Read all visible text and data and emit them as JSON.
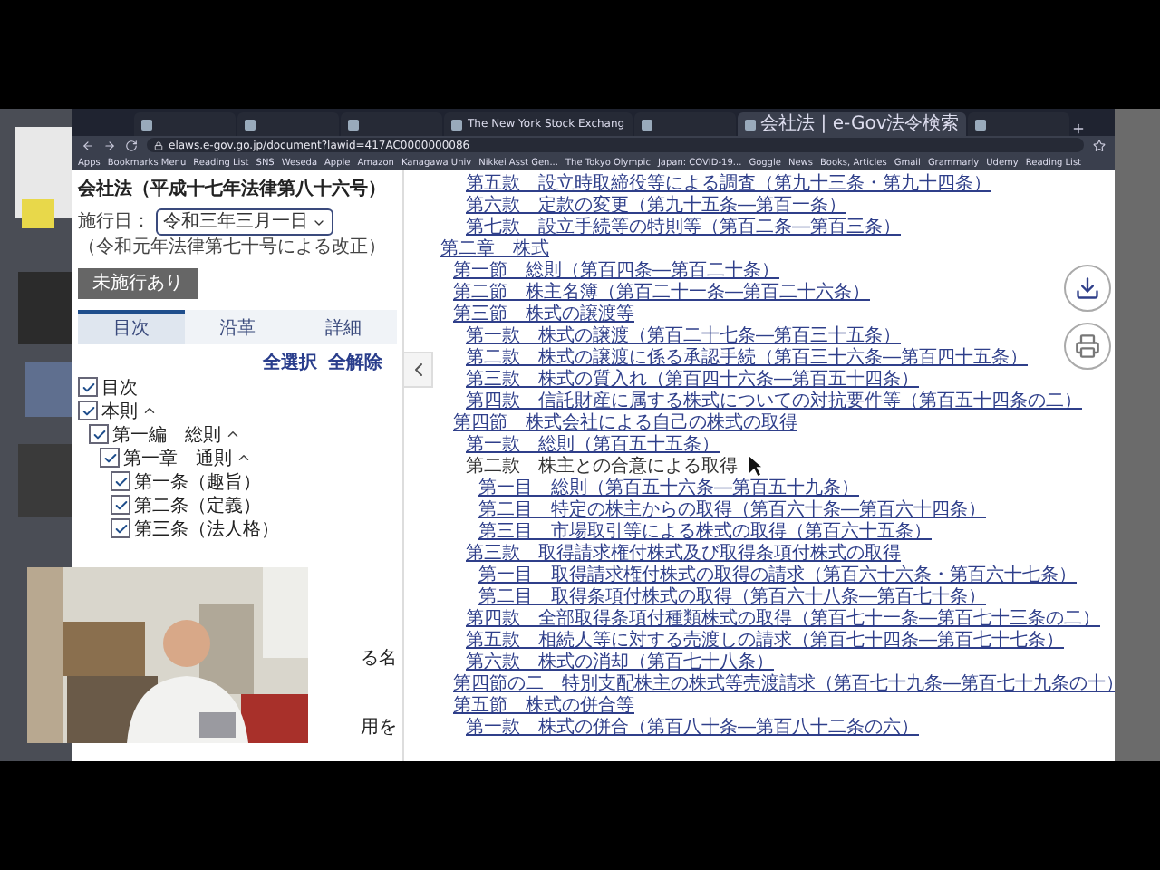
{
  "browser": {
    "tabs": [
      {
        "selected": false
      },
      {
        "selected": false
      },
      {
        "selected": false
      },
      {
        "title": "The New York Stock Exchang",
        "selected": false
      },
      {
        "selected": false
      },
      {
        "title": "会社法 | e-Gov法令検索",
        "selected": true
      },
      {
        "selected": false
      }
    ],
    "address": "elaws.e-gov.go.jp/document?lawid=417AC0000000086",
    "bookmarks": [
      "Apps",
      "Bookmarks Menu",
      "Reading List",
      "SNS",
      "Weseda",
      "Apple",
      "Amazon",
      "Kanagawa Univ",
      "Nikkei Asst Gen...",
      "The Tokyo Olympic",
      "Japan: COVID-19...",
      "Goggle",
      "News",
      "Books, Articles",
      "Gmail",
      "Grammarly",
      "Udemy",
      "Reading List"
    ]
  },
  "sidebar": {
    "law_title": "会社法（平成十七年法律第八十六号）",
    "effective_label": "施行日：",
    "effective_date": "令和三年三月一日",
    "amendment_note": "（令和元年法律第七十号による改正）",
    "pending_button": "未施行あり",
    "tabs": [
      {
        "label": "目次",
        "selected": true
      },
      {
        "label": "沿革",
        "selected": false
      },
      {
        "label": "詳細",
        "selected": false
      }
    ],
    "select_all": "全選択",
    "clear_all": "全解除",
    "tree": [
      {
        "label": "目次",
        "checked": true
      },
      {
        "label": "本則",
        "checked": true,
        "expanded": true,
        "children": [
          {
            "label": "第一編　総則",
            "checked": true,
            "expanded": true,
            "children": [
              {
                "label": "第一章　通則",
                "checked": true,
                "expanded": true,
                "children": [
                  {
                    "label": "第一条（趣旨）",
                    "checked": true
                  },
                  {
                    "label": "第二条（定義）",
                    "checked": true
                  },
                  {
                    "label": "第三条（法人格）",
                    "checked": true
                  }
                ]
              }
            ]
          }
        ]
      }
    ],
    "fragments": [
      "る名",
      "用を"
    ]
  },
  "toc": [
    {
      "children": [
        {
          "children": [
            {
              "text": "第五款　設立時取締役等による調査（第九十三条・第九十四条）",
              "link": true
            },
            {
              "text": "第六款　定款の変更（第九十五条―第百一条）",
              "link": true
            },
            {
              "text": "第七款　設立手続等の特則等（第百二条―第百三条）",
              "link": true
            }
          ]
        }
      ]
    },
    {
      "text": "第二章　株式",
      "link": true,
      "children": [
        {
          "text": "第一節　総則（第百四条―第百二十条）",
          "link": true
        },
        {
          "text": "第二節　株主名簿（第百二十一条―第百二十六条）",
          "link": true
        },
        {
          "text": "第三節　株式の譲渡等",
          "link": true,
          "children": [
            {
              "text": "第一款　株式の譲渡（第百二十七条―第百三十五条）",
              "link": true
            },
            {
              "text": "第二款　株式の譲渡に係る承認手続（第百三十六条―第百四十五条）",
              "link": true
            },
            {
              "text": "第三款　株式の質入れ（第百四十六条―第百五十四条）",
              "link": true
            },
            {
              "text": "第四款　信託財産に属する株式についての対抗要件等（第百五十四条の二）",
              "link": true
            }
          ]
        },
        {
          "text": "第四節　株式会社による自己の株式の取得",
          "link": true,
          "children": [
            {
              "text": "第一款　総則（第百五十五条）",
              "link": true
            },
            {
              "text": "第二款　株主との合意による取得",
              "link": false,
              "children": [
                {
                  "text": "第一目　総則（第百五十六条―第百五十九条）",
                  "link": true
                },
                {
                  "text": "第二目　特定の株主からの取得（第百六十条―第百六十四条）",
                  "link": true
                },
                {
                  "text": "第三目　市場取引等による株式の取得（第百六十五条）",
                  "link": true
                }
              ]
            },
            {
              "text": "第三款　取得請求権付株式及び取得条項付株式の取得",
              "link": true,
              "children": [
                {
                  "text": "第一目　取得請求権付株式の取得の請求（第百六十六条・第百六十七条）",
                  "link": true
                },
                {
                  "text": "第二目　取得条項付株式の取得（第百六十八条―第百七十条）",
                  "link": true
                }
              ]
            },
            {
              "text": "第四款　全部取得条項付種類株式の取得（第百七十一条―第百七十三条の二）",
              "link": true
            },
            {
              "text": "第五款　相続人等に対する売渡しの請求（第百七十四条―第百七十七条）",
              "link": true
            },
            {
              "text": "第六款　株式の消却（第百七十八条）",
              "link": true
            }
          ]
        },
        {
          "text": "第四節の二　特別支配株主の株式等売渡請求（第百七十九条―第百七十九条の十）",
          "link": true
        },
        {
          "text": "第五節　株式の併合等",
          "link": true,
          "children": [
            {
              "text": "第一款　株式の併合（第百八十条―第百八十二条の六）",
              "link": true
            }
          ]
        }
      ]
    }
  ]
}
